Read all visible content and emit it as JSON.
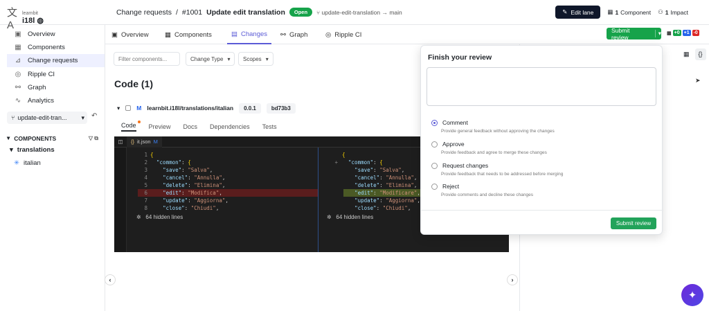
{
  "logo": {
    "org": "learnbit",
    "name": "i18l",
    "mark_icon": "translate-icon"
  },
  "header": {
    "breadcrumb_root": "Change requests",
    "breadcrumb_sep": "/",
    "cr_number": "#1001",
    "cr_title": "Update edit translation",
    "status": "Open",
    "branch": "update-edit-translation → main",
    "edit_lane": "Edit lane",
    "components_count": "1",
    "components_label": "Component",
    "impact_count": "1",
    "impact_label": "Impact"
  },
  "sidebar": {
    "items": [
      {
        "label": "Overview",
        "icon": "overview-icon"
      },
      {
        "label": "Components",
        "icon": "components-icon"
      },
      {
        "label": "Change requests",
        "icon": "change-requests-icon"
      },
      {
        "label": "Ripple CI",
        "icon": "ripple-icon"
      },
      {
        "label": "Graph",
        "icon": "graph-icon"
      },
      {
        "label": "Analytics",
        "icon": "analytics-icon"
      }
    ],
    "lane": "update-edit-tran...",
    "components_header": "COMPONENTS",
    "tree_group": "translations",
    "tree_item": "italian"
  },
  "tabs": [
    {
      "label": "Overview"
    },
    {
      "label": "Components"
    },
    {
      "label": "Changes"
    },
    {
      "label": "Graph"
    },
    {
      "label": "Ripple CI"
    }
  ],
  "submit_review": "Submit review",
  "diff_stats": {
    "files": "+0",
    "added": "+1",
    "removed": "-0"
  },
  "filters": {
    "placeholder": "Filter components...",
    "change_type": "Change Type",
    "scopes": "Scopes"
  },
  "code": {
    "title": "Code (1)",
    "component_status": "M",
    "component_path": "learnbit.i18l/translations/italian",
    "version": "0.0.1",
    "hash": "bd73b3",
    "subtabs": [
      "Code",
      "Preview",
      "Docs",
      "Dependencies",
      "Tests"
    ],
    "file_name": "it.json",
    "file_status": "M",
    "hidden_lines": "64 hidden lines",
    "left_lines": [
      {
        "n": "1",
        "text": "{"
      },
      {
        "n": "2",
        "text": "  \"common\": {"
      },
      {
        "n": "3",
        "text": "    \"save\": \"Salva\","
      },
      {
        "n": "4",
        "text": "    \"cancel\": \"Annulla\","
      },
      {
        "n": "5",
        "text": "    \"delete\": \"Elimina\","
      },
      {
        "n": "6",
        "text": "    \"edit\": \"Modifica\","
      },
      {
        "n": "7",
        "text": "    \"update\": \"Aggiorna\","
      },
      {
        "n": "8",
        "text": "    \"close\": \"Chiudi\","
      }
    ],
    "right_lines": [
      {
        "n": "",
        "text": "{"
      },
      {
        "n": "+",
        "text": "  \"common\": {"
      },
      {
        "n": "",
        "text": "    \"save\": \"Salva\","
      },
      {
        "n": "",
        "text": "    \"cancel\": \"Annulla\","
      },
      {
        "n": "",
        "text": "    \"delete\": \"Elimina\","
      },
      {
        "n": "",
        "text": "    \"edit\": \"Modificare\","
      },
      {
        "n": "",
        "text": "    \"update\": \"Aggiorna\","
      },
      {
        "n": "",
        "text": "    \"close\": \"Chiudi\","
      }
    ]
  },
  "review": {
    "title": "Finish your review",
    "options": [
      {
        "label": "Comment",
        "desc": "Provide general feedback without approving the changes"
      },
      {
        "label": "Approve",
        "desc": "Provide feedback and agree to merge these changes"
      },
      {
        "label": "Request changes",
        "desc": "Provide feedback that needs to be addressed before merging"
      },
      {
        "label": "Reject",
        "desc": "Provide comments and decline these changes"
      }
    ],
    "selected": "Comment",
    "submit": "Submit review"
  },
  "colors": {
    "accent": "#5b5bd6",
    "success": "#16a34a",
    "dark": "#0f172a"
  }
}
